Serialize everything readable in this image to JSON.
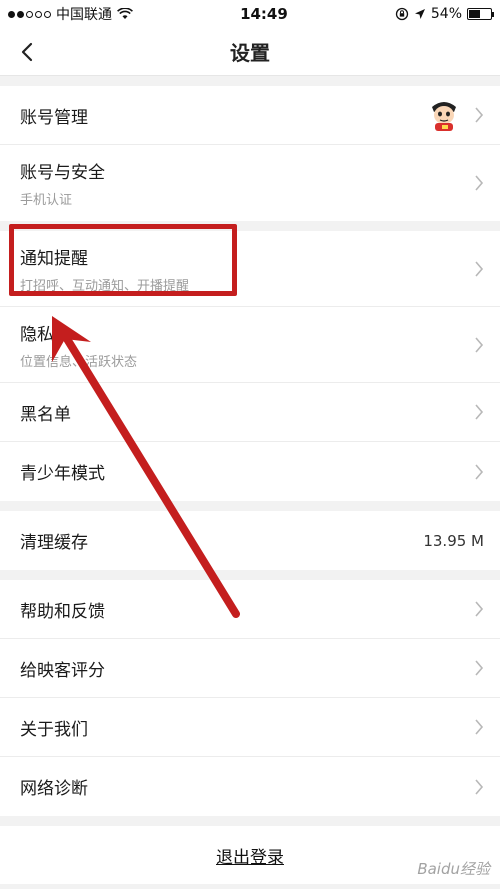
{
  "status_bar": {
    "carrier": "中国联通",
    "time": "14:49",
    "battery": "54%",
    "battery_level": 0.54
  },
  "nav": {
    "title": "设置"
  },
  "groups": [
    {
      "rows": [
        {
          "title": "账号管理",
          "subtitle": "",
          "value": ""
        },
        {
          "title": "账号与安全",
          "subtitle": "手机认证",
          "value": ""
        }
      ]
    },
    {
      "rows": [
        {
          "title": "通知提醒",
          "subtitle": "打招呼、互动通知、开播提醒",
          "value": ""
        },
        {
          "title": "隐私",
          "subtitle": "位置信息、活跃状态",
          "value": ""
        },
        {
          "title": "黑名单",
          "subtitle": "",
          "value": ""
        },
        {
          "title": "青少年模式",
          "subtitle": "",
          "value": ""
        }
      ]
    },
    {
      "rows": [
        {
          "title": "清理缓存",
          "subtitle": "",
          "value": "13.95 M"
        }
      ]
    },
    {
      "rows": [
        {
          "title": "帮助和反馈",
          "subtitle": "",
          "value": ""
        },
        {
          "title": "给映客评分",
          "subtitle": "",
          "value": ""
        },
        {
          "title": "关于我们",
          "subtitle": "",
          "value": ""
        },
        {
          "title": "网络诊断",
          "subtitle": "",
          "value": ""
        }
      ]
    }
  ],
  "logout_label": "退出登录",
  "watermark": "Baidu经验",
  "colors": {
    "annotation": "#c41e1e",
    "background": "#f2f2f2"
  }
}
